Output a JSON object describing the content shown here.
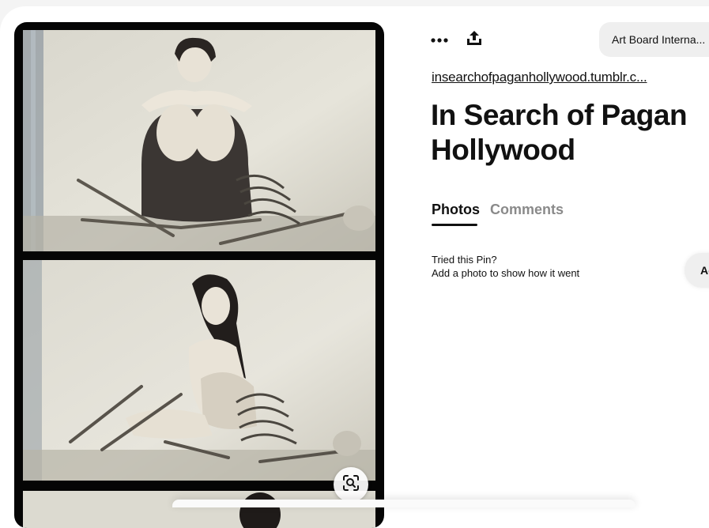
{
  "pin": {
    "board_name": "Art Board Interna...",
    "source_link": "insearchofpaganhollywood.tumblr.c...",
    "title": "In Search of Pagan Hollywood"
  },
  "toolbar": {
    "more_icon": "more-horizontal-icon",
    "share_icon": "share-upload-icon",
    "lens_icon": "visual-search-icon"
  },
  "tabs": [
    {
      "label": "Photos",
      "active": true
    },
    {
      "label": "Comments",
      "active": false
    }
  ],
  "tried": {
    "title": "Tried this Pin?",
    "subtitle": "Add a photo to show how it went",
    "add_button_label": "Ad"
  },
  "colors": {
    "background": "#ffffff",
    "text": "#111111",
    "muted_tab": "#8a8a8a",
    "pill": "#efefef",
    "image_border": "#050505"
  }
}
